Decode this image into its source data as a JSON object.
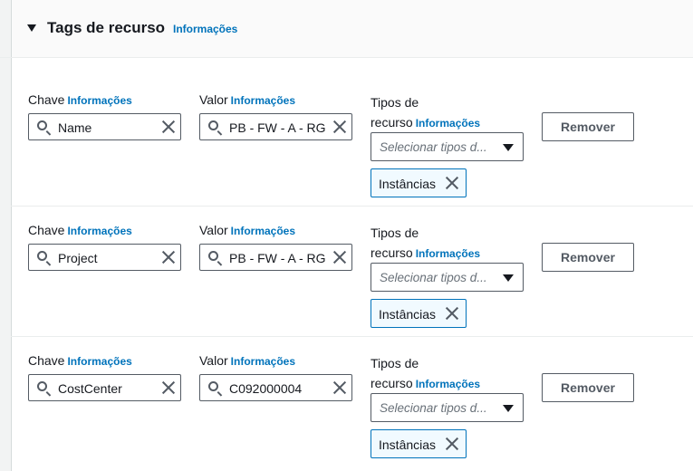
{
  "section": {
    "title": "Tags de recurso",
    "info_link": "Informações"
  },
  "labels": {
    "key": "Chave",
    "value": "Valor",
    "resource_types_line1": "Tipos de",
    "resource_types_line2": "recurso",
    "info": "Informações"
  },
  "rows": [
    {
      "key": "Name",
      "value": "PB - FW - A - RG",
      "select_placeholder": "Selecionar tipos d...",
      "token": "Instâncias",
      "remove": "Remover"
    },
    {
      "key": "Project",
      "value": "PB - FW - A - RG",
      "select_placeholder": "Selecionar tipos d...",
      "token": "Instâncias",
      "remove": "Remover"
    },
    {
      "key": "CostCenter",
      "value": "C092000004",
      "select_placeholder": "Selecionar tipos d...",
      "token": "Instâncias",
      "remove": "Remover"
    }
  ]
}
